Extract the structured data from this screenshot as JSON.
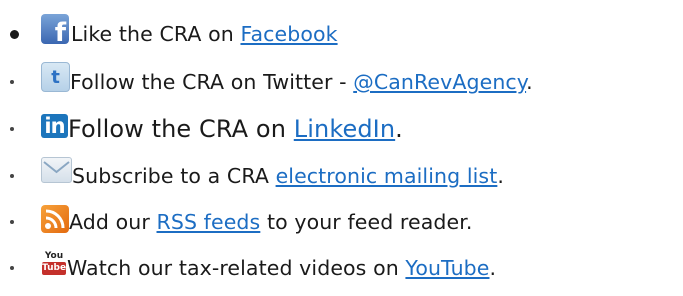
{
  "items": [
    {
      "icon": "facebook-icon",
      "glyph": "f",
      "prefix": "Like the CRA on ",
      "link": "Facebook",
      "suffix": ""
    },
    {
      "icon": "twitter-icon",
      "glyph": "t",
      "prefix": "Follow the CRA on Twitter - ",
      "link": "@CanRevAgency",
      "suffix": "."
    },
    {
      "icon": "linkedin-icon",
      "glyph": "in",
      "prefix": "Follow the CRA on ",
      "link": "LinkedIn",
      "suffix": "."
    },
    {
      "icon": "email-icon",
      "glyph": "",
      "prefix": "Subscribe to a CRA ",
      "link": "electronic mailing list",
      "suffix": "."
    },
    {
      "icon": "rss-icon",
      "glyph": "",
      "prefix": "Add our ",
      "link": "RSS feeds",
      "suffix": " to your feed reader."
    },
    {
      "icon": "youtube-icon",
      "glyph_top": "You",
      "glyph_bottom": "Tube",
      "prefix": "Watch our tax-related videos on ",
      "link": "YouTube",
      "suffix": "."
    }
  ],
  "colors": {
    "link": "#1c6dc3",
    "text": "#1a1a1a"
  }
}
